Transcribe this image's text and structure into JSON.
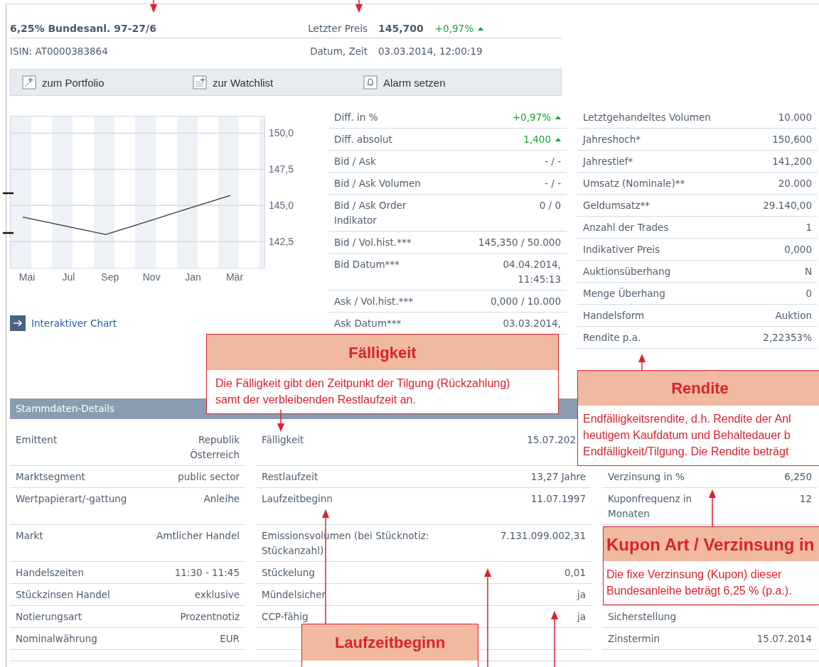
{
  "header": {
    "title": "6,25% Bundesanl. 97-27/6",
    "price_label": "Letzter Preis",
    "price": "145,700",
    "change": "+0,97%",
    "rising": true,
    "isin": "ISIN: AT0000383864",
    "date_label": "Datum, Zeit",
    "date": "03.03.2014, 12:00:19"
  },
  "toolbar": [
    {
      "kind": "portfolio",
      "label": "zum Portfolio"
    },
    {
      "kind": "watchlist",
      "label": "zur Watchlist"
    },
    {
      "kind": "alarm",
      "label": "Alarm setzen"
    }
  ],
  "chart": {
    "chart_data": {
      "type": "line",
      "categories": [
        "Mai",
        "Jul",
        "Sep",
        "Nov",
        "Jan",
        "Mär"
      ],
      "grid": true,
      "series": [
        {
          "color": "#333333",
          "values": [
            144.2,
            143.6,
            143.0,
            143.9,
            144.8,
            145.7
          ]
        }
      ],
      "ylim": [
        140.7,
        151.2
      ],
      "yticks": [
        {
          "value": 142.5,
          "label": "142,5"
        },
        {
          "value": 145,
          "label": "145,0"
        },
        {
          "value": 147.5,
          "label": "147,5"
        },
        {
          "value": 150,
          "label": "150,0"
        }
      ]
    }
  },
  "chart_link": "Interaktiver Chart",
  "quote_table": [
    {
      "label": "Diff. in %",
      "value": "+0,97%",
      "rising": true
    },
    {
      "label": "Diff. absolut",
      "value": "1,400",
      "rising": true
    },
    {
      "label": "Bid / Ask",
      "value": "- / -",
      "rising": false
    },
    {
      "label": "Bid / Ask Volumen",
      "value": "- / -",
      "rising": false
    },
    {
      "label": "Bid / Ask Order Indikator",
      "value": "0 / 0",
      "rising": false
    },
    {
      "label": "Bid / Vol.hist.***",
      "value": "145,350 / 50.000",
      "rising": false
    },
    {
      "label": "Bid Datum***",
      "value": "04.04.2014, 11:45:13",
      "rising": false
    },
    {
      "label": "Ask / Vol.hist.***",
      "value": "0,000 / 10.000",
      "rising": false
    },
    {
      "label": "Ask Datum***",
      "value": "03.03.2014,",
      "rising": false
    }
  ],
  "stats_table": [
    {
      "label": "Letztgehandeltes Volumen",
      "value": "10.000"
    },
    {
      "label": "Jahreshoch*",
      "value": "150,600"
    },
    {
      "label": "Jahrestief*",
      "value": "141,200"
    },
    {
      "label": "Umsatz (Nominale)**",
      "value": "20.000"
    },
    {
      "label": "Geldumsatz**",
      "value": "29.140,00"
    },
    {
      "label": "Anzahl der Trades",
      "value": "1"
    },
    {
      "label": "Indikativer Preis",
      "value": "0,000"
    },
    {
      "label": "Auktionsüberhang",
      "value": "N"
    },
    {
      "label": "Menge Überhang",
      "value": "0"
    },
    {
      "label": "Handelsform",
      "value": "Auktion"
    },
    {
      "label": "Rendite p.a.",
      "value": "2,22353%"
    }
  ],
  "stammdaten": {
    "title": "Stammdaten-Details",
    "rows": [
      [
        {
          "label": "Emittent",
          "value": "Republik Österreich"
        },
        {
          "label": "Fälligkeit",
          "value": "15.07.202"
        },
        {}
      ],
      [
        {
          "label": "Marktsegment",
          "value": "public sector"
        },
        {
          "label": "Restlaufzeit",
          "value": "13,27 Jahre"
        },
        {
          "label": "Verzinsung in %",
          "value": "6,250"
        }
      ],
      [
        {
          "label": "Wertpapierart/-gattung",
          "value": "Anleihe"
        },
        {
          "label": "Laufzeitbeginn",
          "value": "11.07.1997"
        },
        {
          "label": "Kuponfrequenz in Monaten",
          "value": "12"
        }
      ],
      [
        {
          "label": "Markt",
          "value": "Amtlicher Handel"
        },
        {
          "label": "Emissionsvolumen (bei Stücknotiz: Stückanzahl)",
          "value": "7.131.099.002,31"
        },
        {}
      ],
      [
        {
          "label": "Handelszeiten",
          "value": "11:30 - 11:45"
        },
        {
          "label": "Stückelung",
          "value": "0,01"
        },
        {}
      ],
      [
        {
          "label": "Stückzinsen Handel",
          "value": "exklusive"
        },
        {
          "label": "Mündelsicher",
          "value": "ja"
        },
        {}
      ],
      [
        {
          "label": "Notierungsart",
          "value": "Prozentnotiz"
        },
        {
          "label": "CCP-fähig",
          "value": "ja"
        },
        {
          "label": "Sicherstellung"
        }
      ],
      [
        {
          "label": "Nominalwährung",
          "value": "EUR"
        },
        {},
        {
          "label": "Zinstermin",
          "value": "15.07.2014"
        }
      ]
    ]
  },
  "callouts": [
    {
      "title": "Fälligkeit",
      "lines": [
        "Die Fälligkeit gibt den Zeitpunkt der Tilgung (Rückzahlung)",
        "samt der verbleibenden Restlaufzeit an."
      ]
    },
    {
      "title": "Rendite",
      "lines": [
        "Endfälligkeitsrendite, d.h. Rendite der Anl",
        "heutigem Kaufdatum und Behaltedauer b",
        "Endfälligkeit/Tilgung. Die Rendite beträgt"
      ]
    },
    {
      "title": "Kupon Art / Verzinsung in",
      "lines": [
        "Die fixe Verzinsung (Kupon) dieser",
        "Bundesanleihe beträgt 6,25 % (p.a.)."
      ]
    },
    {
      "title": "Laufzeitbeginn"
    }
  ]
}
